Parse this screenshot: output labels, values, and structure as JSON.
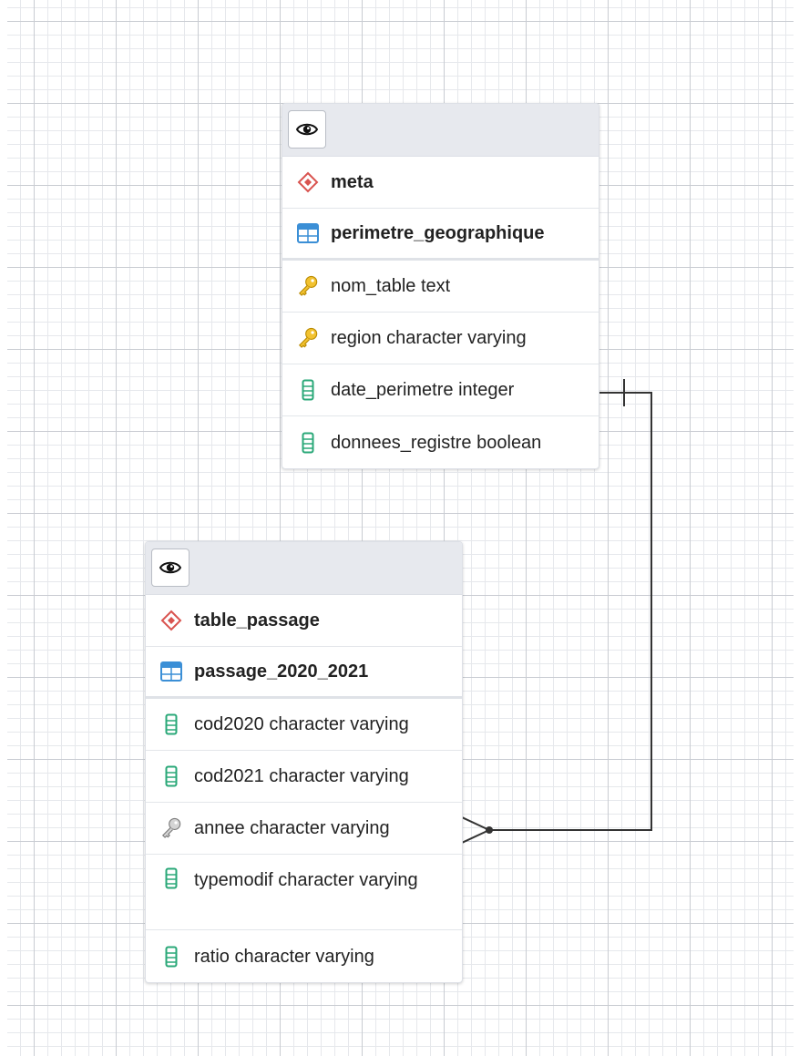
{
  "tables": [
    {
      "schema": "meta",
      "table": "perimetre_geographique",
      "columns": [
        {
          "name": "nom_table",
          "type": "text",
          "icon": "primary-key-icon"
        },
        {
          "name": "region",
          "type": "character varying",
          "icon": "primary-key-icon"
        },
        {
          "name": "date_perimetre",
          "type": "integer",
          "icon": "column-icon"
        },
        {
          "name": "donnees_registre",
          "type": "boolean",
          "icon": "column-icon"
        }
      ]
    },
    {
      "schema": "table_passage",
      "table": "passage_2020_2021",
      "columns": [
        {
          "name": "cod2020",
          "type": "character varying",
          "icon": "column-icon"
        },
        {
          "name": "cod2021",
          "type": "character varying",
          "icon": "column-icon"
        },
        {
          "name": "annee",
          "type": "character varying",
          "icon": "foreign-key-icon"
        },
        {
          "name": "typemodif",
          "type": "character varying",
          "icon": "column-icon"
        },
        {
          "name": "ratio",
          "type": "character varying",
          "icon": "column-icon"
        }
      ]
    }
  ],
  "relationship": {
    "from": "perimetre_geographique",
    "to": "passage_2020_2021",
    "cardinality_from": "one",
    "cardinality_to": "many"
  },
  "colors": {
    "schema_icon": "#d9534f",
    "table_icon": "#3b8fd6",
    "primary_key": "#e0a800",
    "foreign_key": "#8a8a8a",
    "column_icon": "#2aa878",
    "header_bg": "#e7e9ee",
    "link_line": "#333333"
  }
}
